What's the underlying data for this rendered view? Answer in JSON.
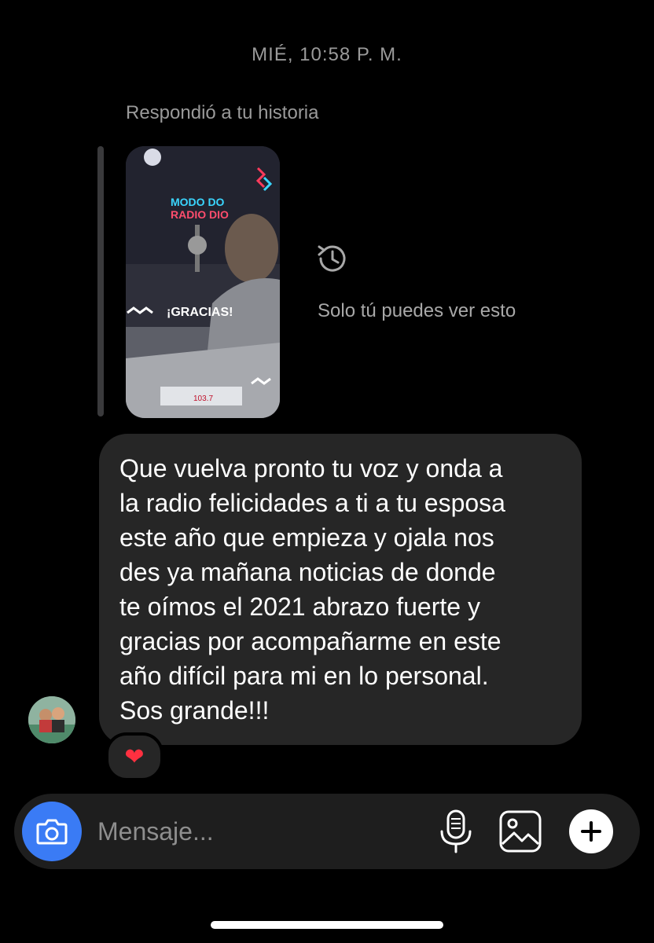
{
  "header": {
    "timestamp": "MIÉ, 10:58 P. M."
  },
  "story_reply": {
    "label": "Respondió a tu historia",
    "visibility_note": "Solo tú puedes ver esto",
    "visibility_icon": "history-icon",
    "story_texts": {
      "brand_top": "MODO DO",
      "brand_bottom": "RADIO DIO",
      "headline": "¡GRACIAS!",
      "station": "103.7"
    }
  },
  "message": {
    "text": "Que vuelva pronto tu voz y onda a\nla radio felicidades a ti a tu esposa\neste año que empieza y ojala nos\ndes ya mañana noticias de donde\nte oímos el 2021 abrazo fuerte y\ngracias por acompañarme en este\naño difícil para mi en lo personal.\nSos grande!!!",
    "reaction": "❤",
    "reaction_color": "#ff3040"
  },
  "composer": {
    "placeholder": "Mensaje...",
    "camera_icon": "camera-icon",
    "mic_icon": "microphone-icon",
    "gallery_icon": "image-icon",
    "add_icon": "plus-icon",
    "camera_color": "#3a7bf5"
  }
}
